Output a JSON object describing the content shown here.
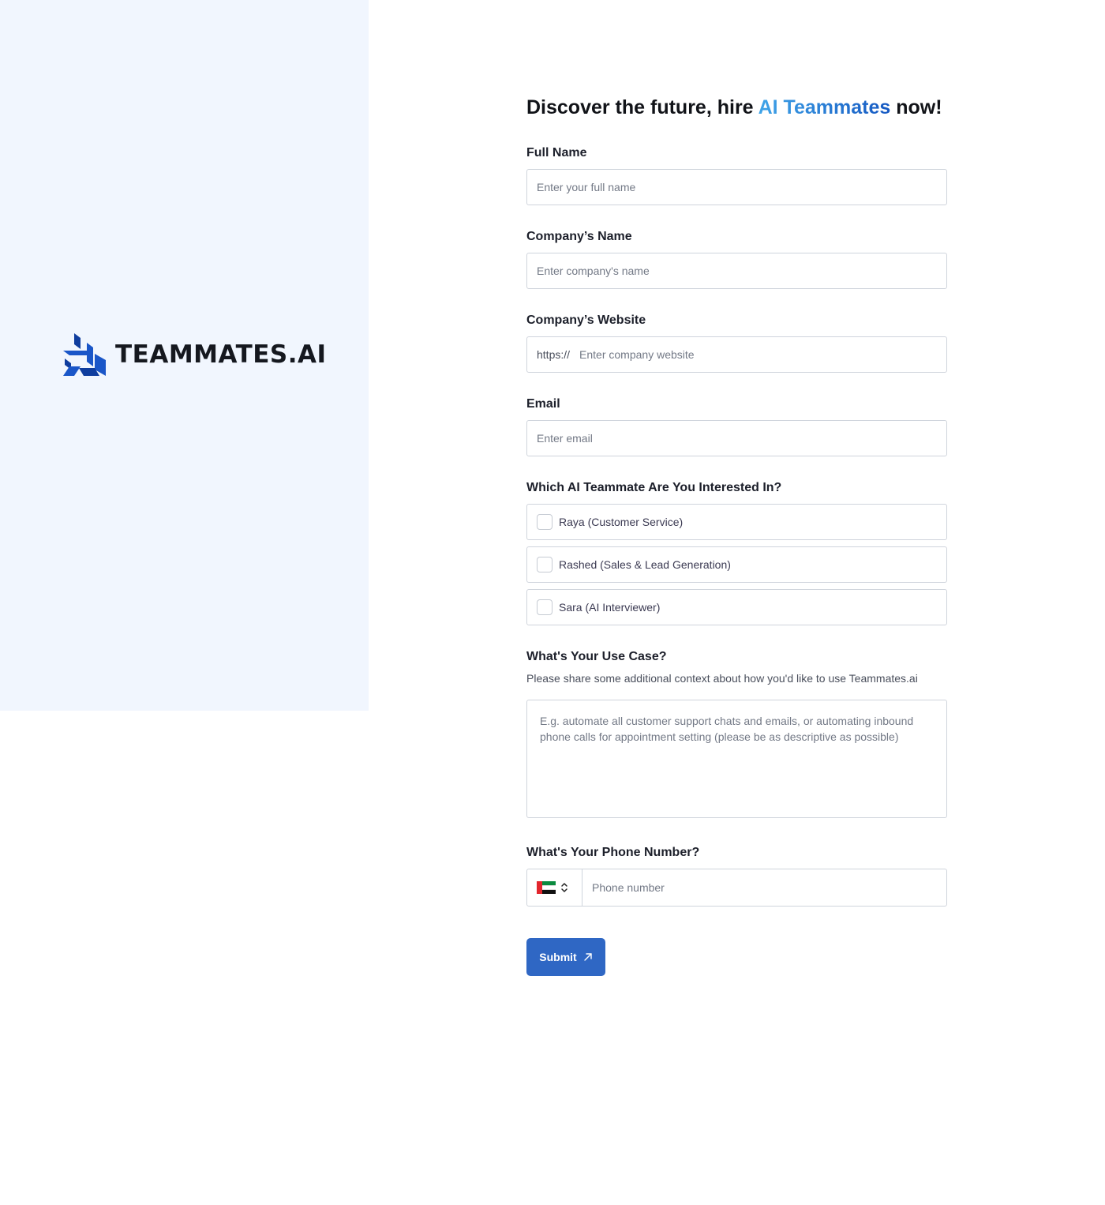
{
  "brand": {
    "logo_text": "TEAMMATES.AI",
    "logo_icon": "teammates-logo-icon",
    "accent_colors": [
      "#3fa4e8",
      "#1558c2"
    ]
  },
  "headline": {
    "prefix": "Discover the future, hire ",
    "accent": "AI Teammates",
    "suffix": " now!"
  },
  "fields": {
    "full_name": {
      "label": "Full Name",
      "placeholder": "Enter your full name",
      "value": ""
    },
    "company_name": {
      "label": "Company’s Name",
      "placeholder": "Enter company's name",
      "value": ""
    },
    "company_website": {
      "label": "Company’s Website",
      "prefix": "https://",
      "placeholder": "Enter company website",
      "value": ""
    },
    "email": {
      "label": "Email",
      "placeholder": "Enter email",
      "value": ""
    }
  },
  "teammates": {
    "label": "Which AI Teammate Are You Interested In?",
    "options": [
      {
        "label": "Raya (Customer Service)",
        "checked": false
      },
      {
        "label": "Rashed (Sales & Lead Generation)",
        "checked": false
      },
      {
        "label": "Sara (AI Interviewer)",
        "checked": false
      }
    ]
  },
  "use_case": {
    "label": "What's Your Use Case?",
    "help": "Please share some additional context about how you'd like to use Teammates.ai",
    "placeholder": "E.g. automate all customer support chats and emails, or automating inbound phone calls for appointment setting (please be as descriptive as possible)",
    "value": ""
  },
  "phone": {
    "label": "What's Your Phone Number?",
    "country_flag_icon": "uae-flag-icon",
    "placeholder": "Phone number",
    "value": ""
  },
  "submit": {
    "label": "Submit",
    "icon": "arrow-up-right-icon",
    "color": "#2f67c4"
  }
}
